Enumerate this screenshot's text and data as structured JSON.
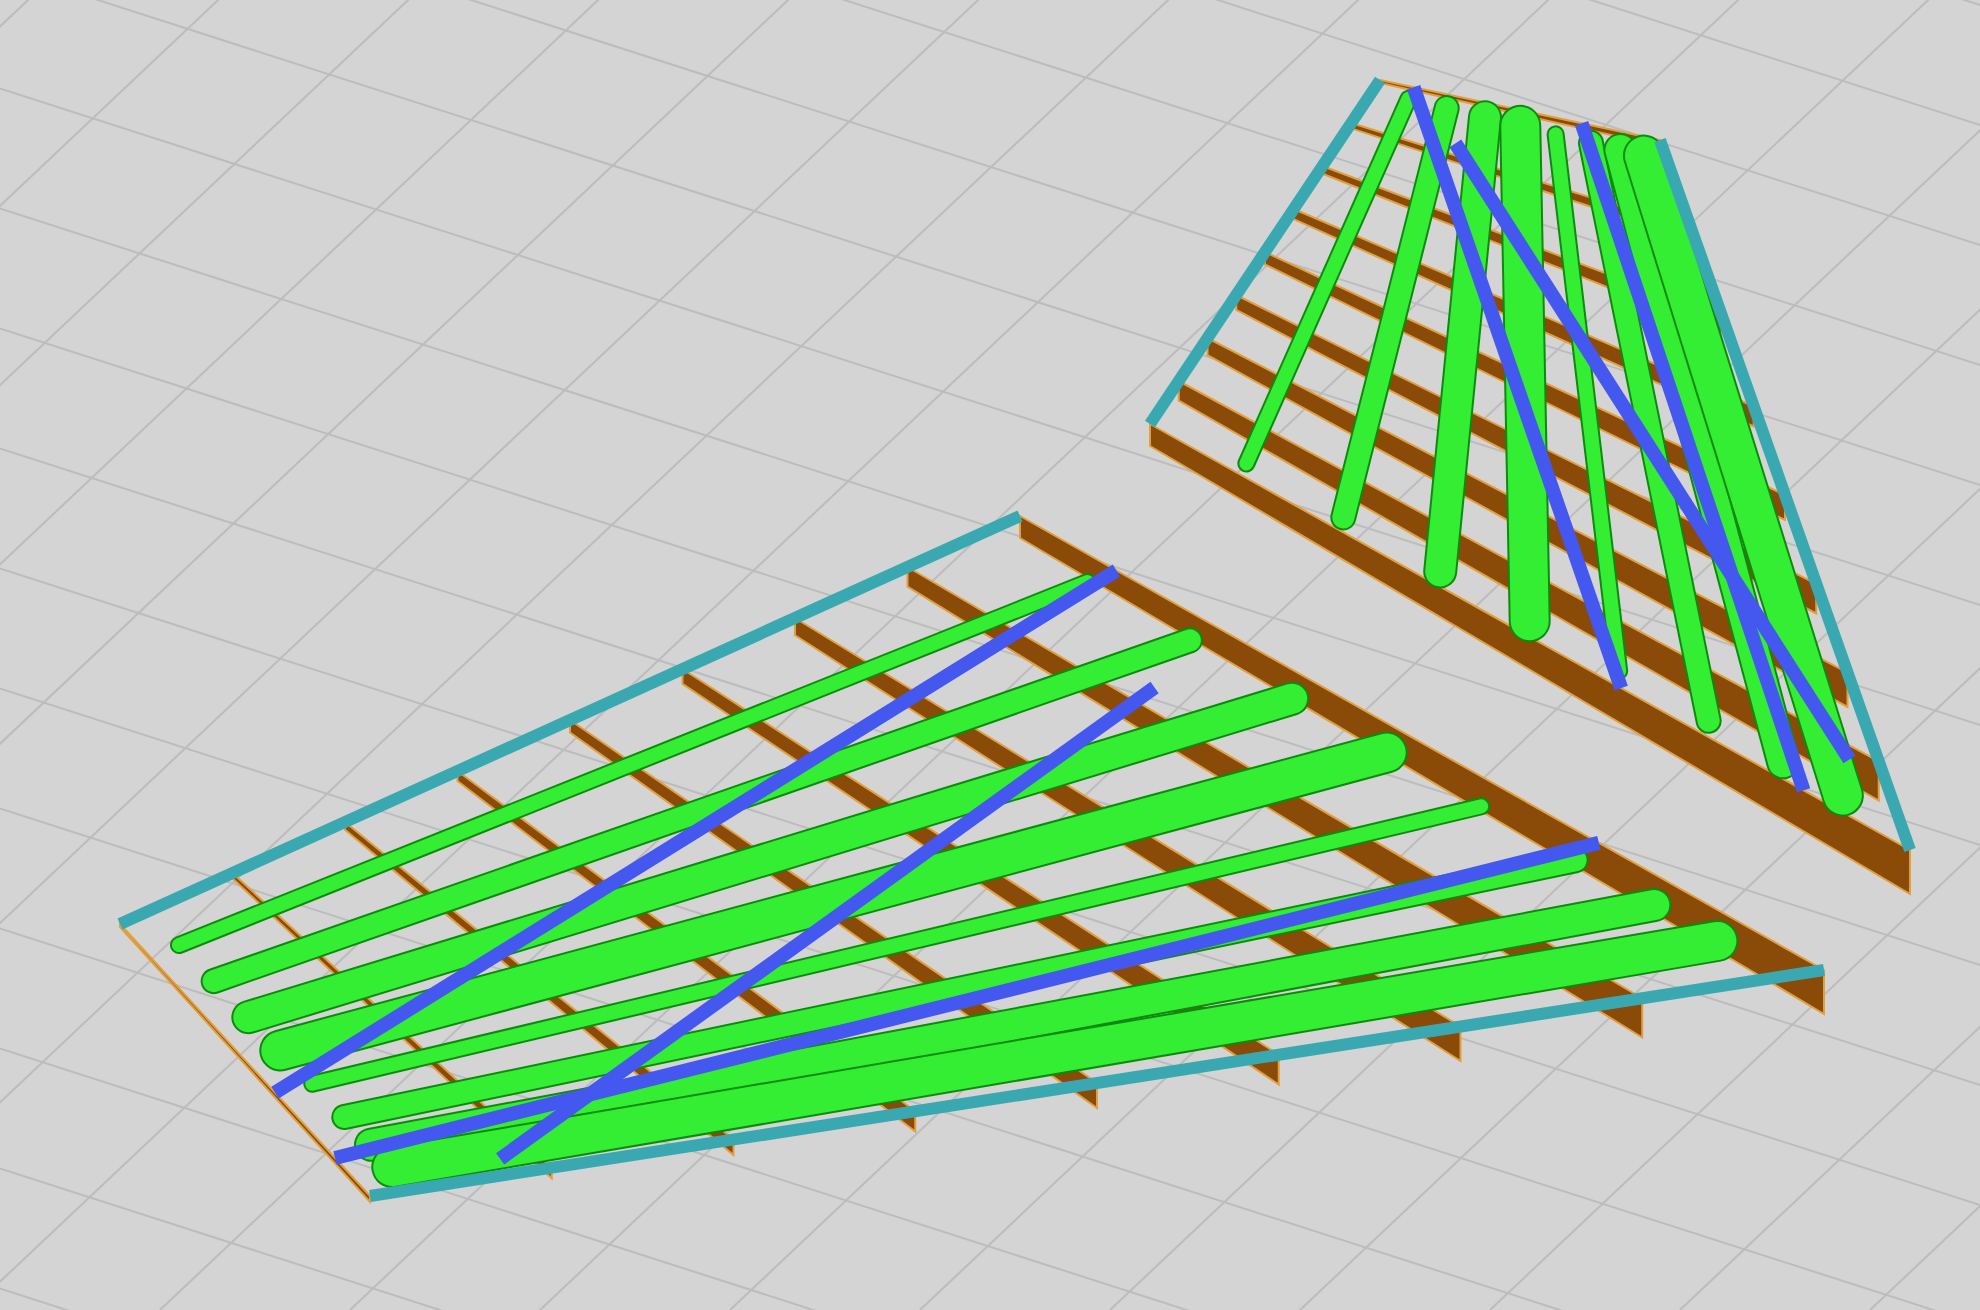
{
  "viewport": {
    "kind": "render"
  }
}
